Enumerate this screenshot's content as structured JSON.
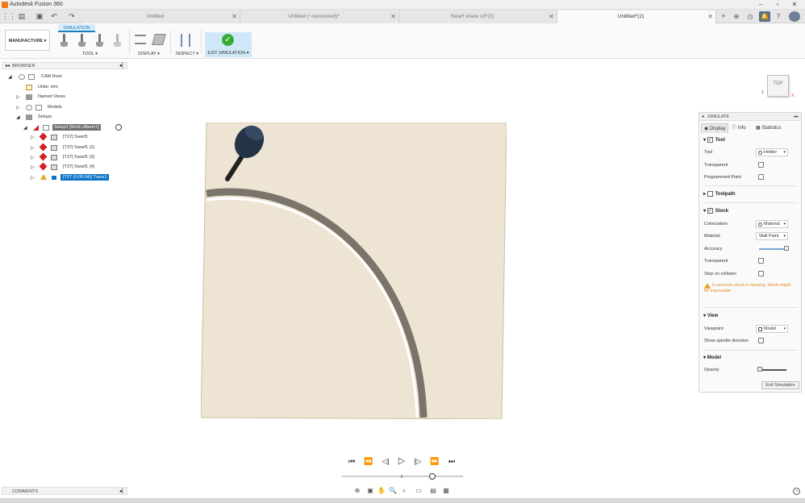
{
  "window": {
    "title": "Autodesk Fusion 360"
  },
  "tabs": [
    {
      "label": "Untitled",
      "active": false
    },
    {
      "label": "Untitled (~recovered)*",
      "active": false
    },
    {
      "label": "Swarf share v3*(2)",
      "active": false
    },
    {
      "label": "Untitled*(2)",
      "active": true
    }
  ],
  "toolbar": {
    "workspace": "MANUFACTURE ▾",
    "active_tab": "SIMULATION",
    "groups": {
      "tool": "TOOL ▾",
      "display": "DISPLAY ▾",
      "inspect": "INSPECT ▾",
      "exit": "EXIT SIMULATION ▾"
    }
  },
  "browser": {
    "title": "BROWSER",
    "items": [
      {
        "label": "CAM Root"
      },
      {
        "label": "Units: mm"
      },
      {
        "label": "Named Views"
      },
      {
        "label": "Models"
      },
      {
        "label": "Setups"
      },
      {
        "label": "Setup3 [Work offset=1]"
      },
      {
        "label": "[T37] Swarf1"
      },
      {
        "label": "[T37] Swarf1 (2)"
      },
      {
        "label": "[T37] Swarf1 (3)"
      },
      {
        "label": "[T37] Swarf1 (4)"
      },
      {
        "label": "[T37 (0:00:04)] Trace1"
      }
    ]
  },
  "viewcube": {
    "label": "TOP",
    "axis_x": "X",
    "axis_z": "Z"
  },
  "simulate_panel": {
    "title": "SIMULATE",
    "tabs": [
      "Display",
      "Info",
      "Statistics"
    ],
    "tool": {
      "header": "Tool",
      "tool_label": "Tool",
      "tool_value": "Holder",
      "transparent": "Transparent",
      "programmed_point": "Programmed Point"
    },
    "toolpath": {
      "header": "Toolpath"
    },
    "stock": {
      "header": "Stock",
      "colorization_label": "Colorization",
      "colorization_value": "Material",
      "material_label": "Material",
      "material_value": "Wall Paint",
      "accuracy_label": "Accuracy",
      "accuracy_level": 0.95,
      "transparent": "Transparent",
      "stop_on_collision": "Stop on collision",
      "warning": "In process stock is missing. Stock might be inaccurate"
    },
    "view": {
      "header": "View",
      "viewpoint_label": "Viewpoint",
      "viewpoint_value": "Model",
      "show_spindle": "Show spindle direction"
    },
    "model": {
      "header": "Model",
      "opacity_label": "Opacity",
      "opacity_level": 0.0
    },
    "exit_button": "Exit Simulation"
  },
  "playback": {
    "position": 0.85
  },
  "comments": {
    "title": "COMMENTS"
  },
  "colors": {
    "accent": "#0d74c7",
    "stock": "#ede4d3",
    "ok_green": "#3aaa35",
    "warning": "#e08a1f"
  }
}
